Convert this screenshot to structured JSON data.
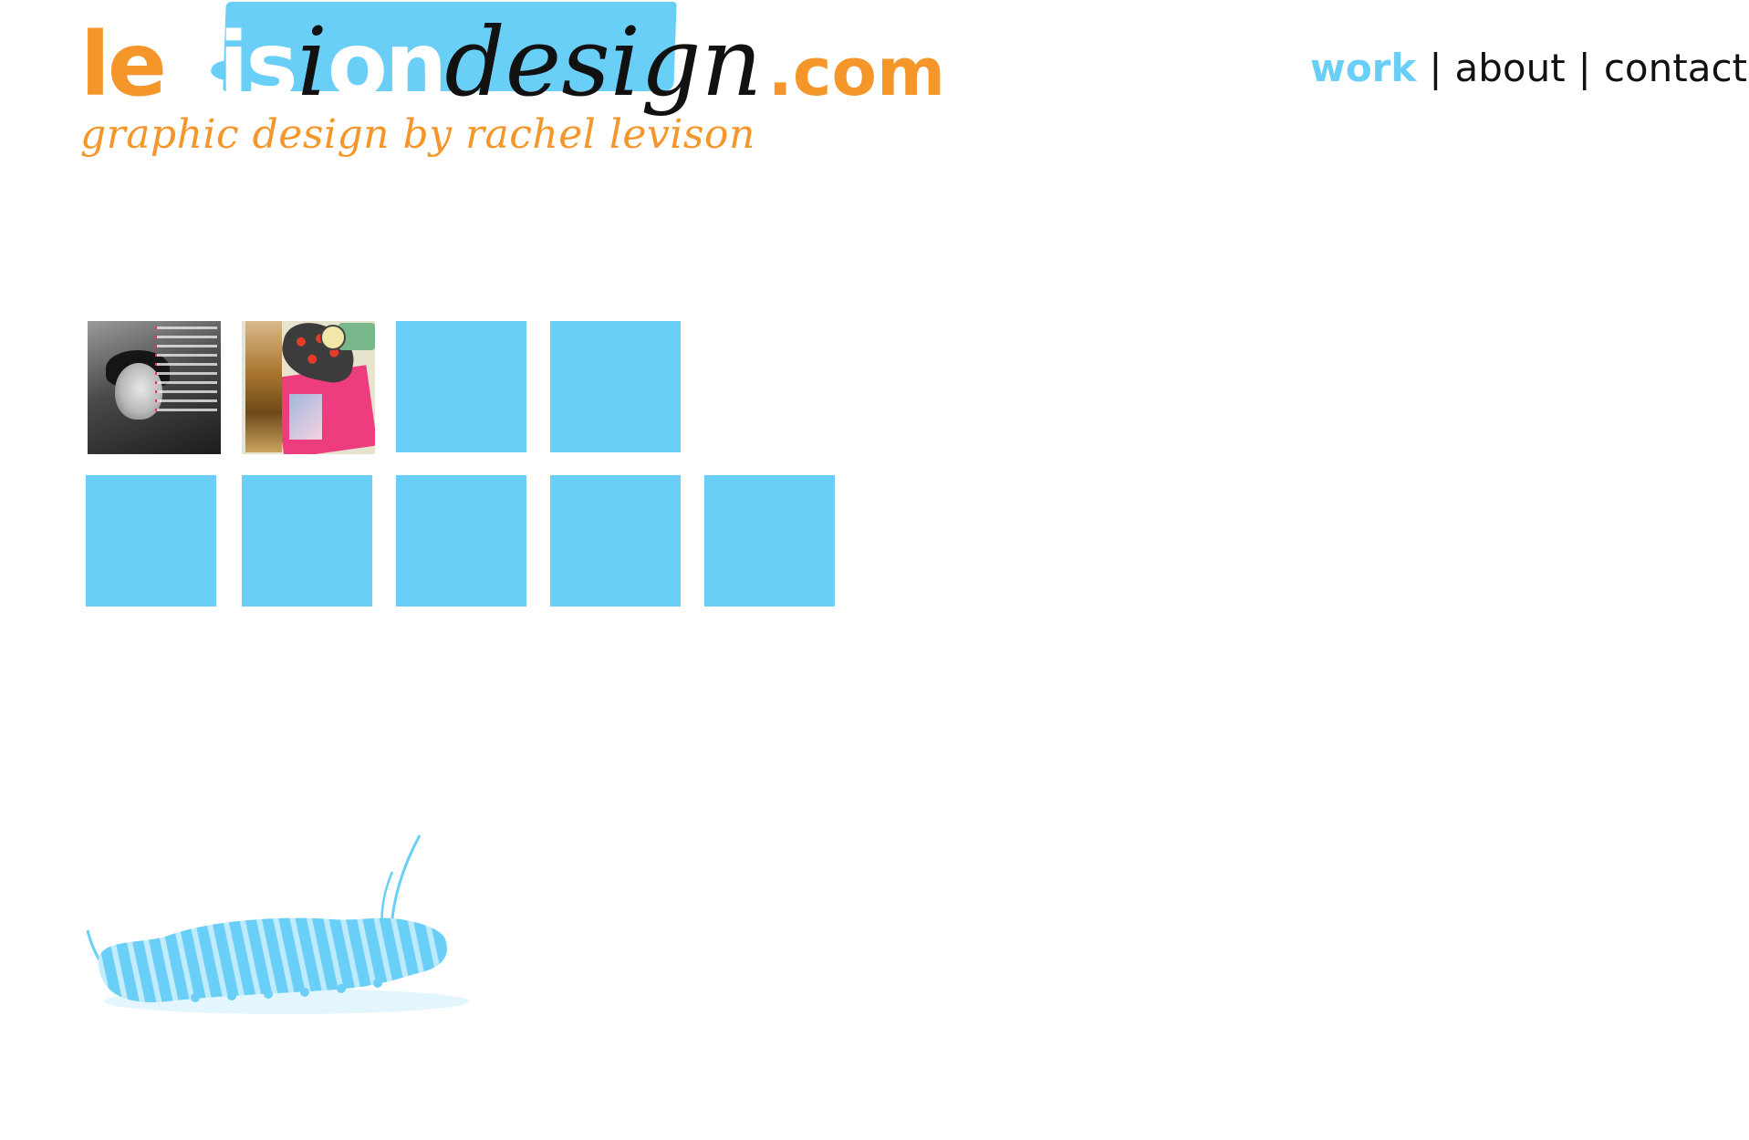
{
  "logo": {
    "part_lev": "le",
    "part_v": "v",
    "part_isi": "is",
    "part_i2": "i",
    "part_on": "on",
    "part_design": "design",
    "part_com": ".com"
  },
  "tagline": "graphic design by rachel levison",
  "nav": {
    "items": [
      {
        "label": "work",
        "active": true
      },
      {
        "label": "about",
        "active": false
      },
      {
        "label": "contact",
        "active": false
      }
    ],
    "separator": "|"
  },
  "portfolio": {
    "tiles": [
      {
        "kind": "thumbnail",
        "subject": "magazine-spread-bw"
      },
      {
        "kind": "thumbnail",
        "subject": "fashion-collage"
      },
      {
        "kind": "placeholder"
      },
      {
        "kind": "placeholder"
      },
      {
        "kind": "placeholder"
      },
      {
        "kind": "placeholder"
      },
      {
        "kind": "placeholder"
      },
      {
        "kind": "placeholder"
      },
      {
        "kind": "placeholder"
      }
    ]
  },
  "colors": {
    "accent_blue": "#6acff6",
    "accent_orange": "#f4962a",
    "text": "#111111",
    "background": "#ffffff"
  },
  "decoration": {
    "icon": "caterpillar-icon"
  }
}
